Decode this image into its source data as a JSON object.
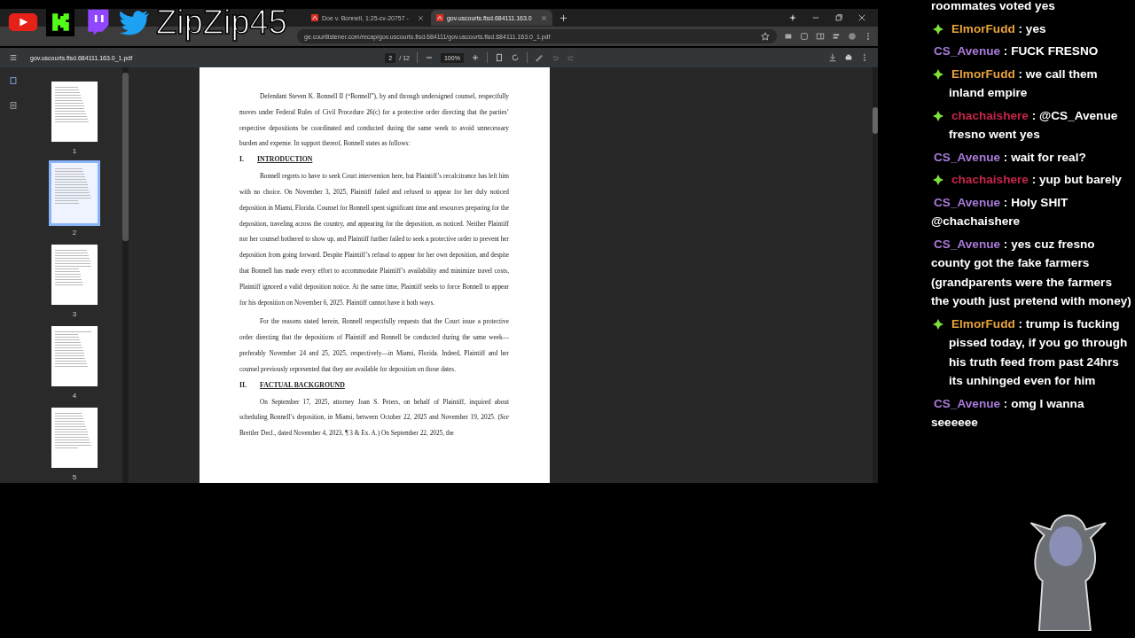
{
  "overlay": {
    "channel_name": "ZipZip45"
  },
  "browser": {
    "tabs": [
      {
        "label": "Doe v. Bonnell, 1:25-cv-20757 -",
        "selected": false
      },
      {
        "label": "gov.uscourts.flsd.684111.163.0",
        "selected": true
      }
    ],
    "address": "ge.courtlistener.com/recap/gov.uscourts.flsd.684111/gov.uscourts.flsd.684111.163.0_1.pdf"
  },
  "pdf_toolbar": {
    "filename": "gov.uscourts.flsd.684111.163.0_1.pdf",
    "page": "2",
    "page_total": "/ 12",
    "zoom": "100%"
  },
  "thumbnails": [
    {
      "label": "1",
      "selected": false
    },
    {
      "label": "2",
      "selected": true
    },
    {
      "label": "3",
      "selected": false
    },
    {
      "label": "4",
      "selected": false
    },
    {
      "label": "5",
      "selected": false
    }
  ],
  "document": [
    {
      "kind": "para",
      "text": "Defendant Steven K. Bonnell II (“Bonnell”), by and through undersigned counsel, respectfully moves under Federal Rules of Civil Procedure 26(c) for a protective order directing that the parties’ respective depositions be coordinated and conducted during the same week to avoid unnecessary burden and expense. In support thereof, Bonnell states as follows:"
    },
    {
      "kind": "heading",
      "number": "I.",
      "text": "INTRODUCTION"
    },
    {
      "kind": "para",
      "text": "Bonnell regrets to have to seek Court intervention here, but Plaintiff’s recalcitrance has left him with no choice. On November 3, 2025, Plaintiff failed and refused to appear for her duly noticed deposition in Miami, Florida. Counsel for Bonnell spent significant time and resources preparing for the deposition, traveling across the country, and appearing for the deposition, as noticed. Neither Plaintiff nor her counsel bothered to show up, and Plaintiff further failed to seek a protective order to prevent her deposition from going forward. Despite Plaintiff’s refusal to appear for her own deposition, and despite that Bonnell has made every effort to accommodate Plaintiff’s availability and minimize travel costs, Plaintiff  ignored a valid deposition notice. At the same time, Plaintiff seeks to force Bonnell to appear for his deposition on November 6, 2025. Plaintiff cannot have it both ways."
    },
    {
      "kind": "para",
      "text": "For the reasons stated herein, Bonnell respectfully requests that the Court issue a protective order directing that the depositions of Plaintiff and Bonnell be conducted during the same week—preferably November 24 and 25, 2025, respectively—in Miami, Florida. Indeed, Plaintiff and her counsel previously represented that they are available for deposition on those dates."
    },
    {
      "kind": "heading",
      "number": "II.",
      "text": "FACTUAL BACKGROUND"
    },
    {
      "kind": "para",
      "text": "On September 17, 2025, attorney Joan S. Peters, on behalf of Plaintiff, inquired about scheduling Bonnell’s deposition, in Miami, between October 22, 2025 and November 19, 2025. (*See* Brettler Decl., dated November 4, 2023, ¶ 3 & Ex. A.) On September 22, 2025, the"
    }
  ],
  "chat": [
    {
      "text": "roommates voted yes"
    },
    {
      "badge": true,
      "user": "ElmorFudd",
      "color": "#e8a33a",
      "text": ": yes"
    },
    {
      "badge": false,
      "user": "CS_Avenue",
      "color": "#a97ad8",
      "text": ": FUCK FRESNO"
    },
    {
      "badge": true,
      "user": "ElmorFudd",
      "color": "#e8a33a",
      "text": ": we call them inland empire"
    },
    {
      "badge": true,
      "user": "chachaishere",
      "color": "#c8244a",
      "text": ": @CS_Avenue fresno went yes"
    },
    {
      "badge": false,
      "user": "CS_Avenue",
      "color": "#a97ad8",
      "text": ": wait for real?"
    },
    {
      "badge": true,
      "user": "chachaishere",
      "color": "#c8244a",
      "text": ": yup but barely"
    },
    {
      "badge": false,
      "user": "CS_Avenue",
      "color": "#a97ad8",
      "text": ": Holy SHIT @chachaishere"
    },
    {
      "badge": false,
      "user": "CS_Avenue",
      "color": "#a97ad8",
      "text": ": yes cuz fresno county got the fake farmers (grandparents were the farmers the youth just pretend with money)"
    },
    {
      "badge": true,
      "user": "ElmorFudd",
      "color": "#e8a33a",
      "text": ": trump is fucking pissed today, if you go through his truth feed from past 24hrs its unhinged even for him"
    },
    {
      "badge": false,
      "user": "CS_Avenue",
      "color": "#a97ad8",
      "text": ": omg I wanna seeeeee"
    }
  ]
}
